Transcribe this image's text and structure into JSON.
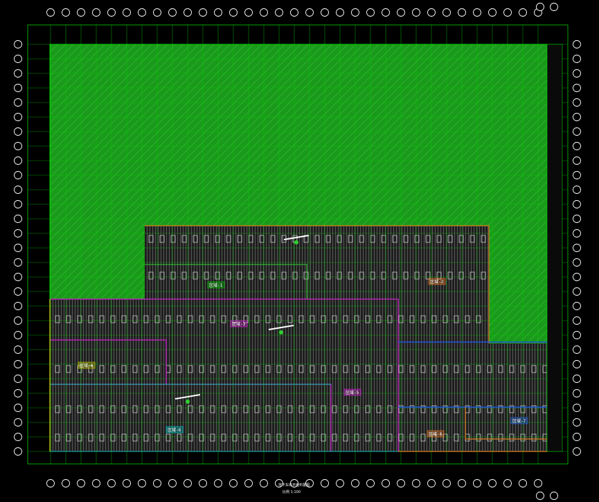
{
  "drawing": {
    "title": "地下车库平面布置图",
    "scale": "比例  1:100"
  },
  "zone_labels": [
    {
      "id": "zone-a",
      "text": "区域-1",
      "color": "#00c000"
    },
    {
      "id": "zone-b",
      "text": "区域-2",
      "color": "#e07020"
    },
    {
      "id": "zone-c",
      "text": "区域-3",
      "color": "#d020d0"
    },
    {
      "id": "zone-d",
      "text": "区域-4",
      "color": "#c0c000"
    },
    {
      "id": "zone-e",
      "text": "区域-5",
      "color": "#d020d0"
    },
    {
      "id": "zone-f",
      "text": "区域-6",
      "color": "#00c0c0"
    },
    {
      "id": "zone-g",
      "text": "区域-7",
      "color": "#2060e0"
    },
    {
      "id": "zone-h",
      "text": "区域-8",
      "color": "#e07020"
    }
  ],
  "colors": {
    "background": "#000000",
    "hatch": "#1a9a1a",
    "hatch_line": "#5fe05f",
    "grid": "#00d000",
    "parking": "#3a3a3a",
    "bubble": "#ffffff",
    "magenta": "#d020d0",
    "orange": "#e08020",
    "cyan": "#10c0c0",
    "blue": "#2050e0",
    "yellow": "#c8c800"
  }
}
